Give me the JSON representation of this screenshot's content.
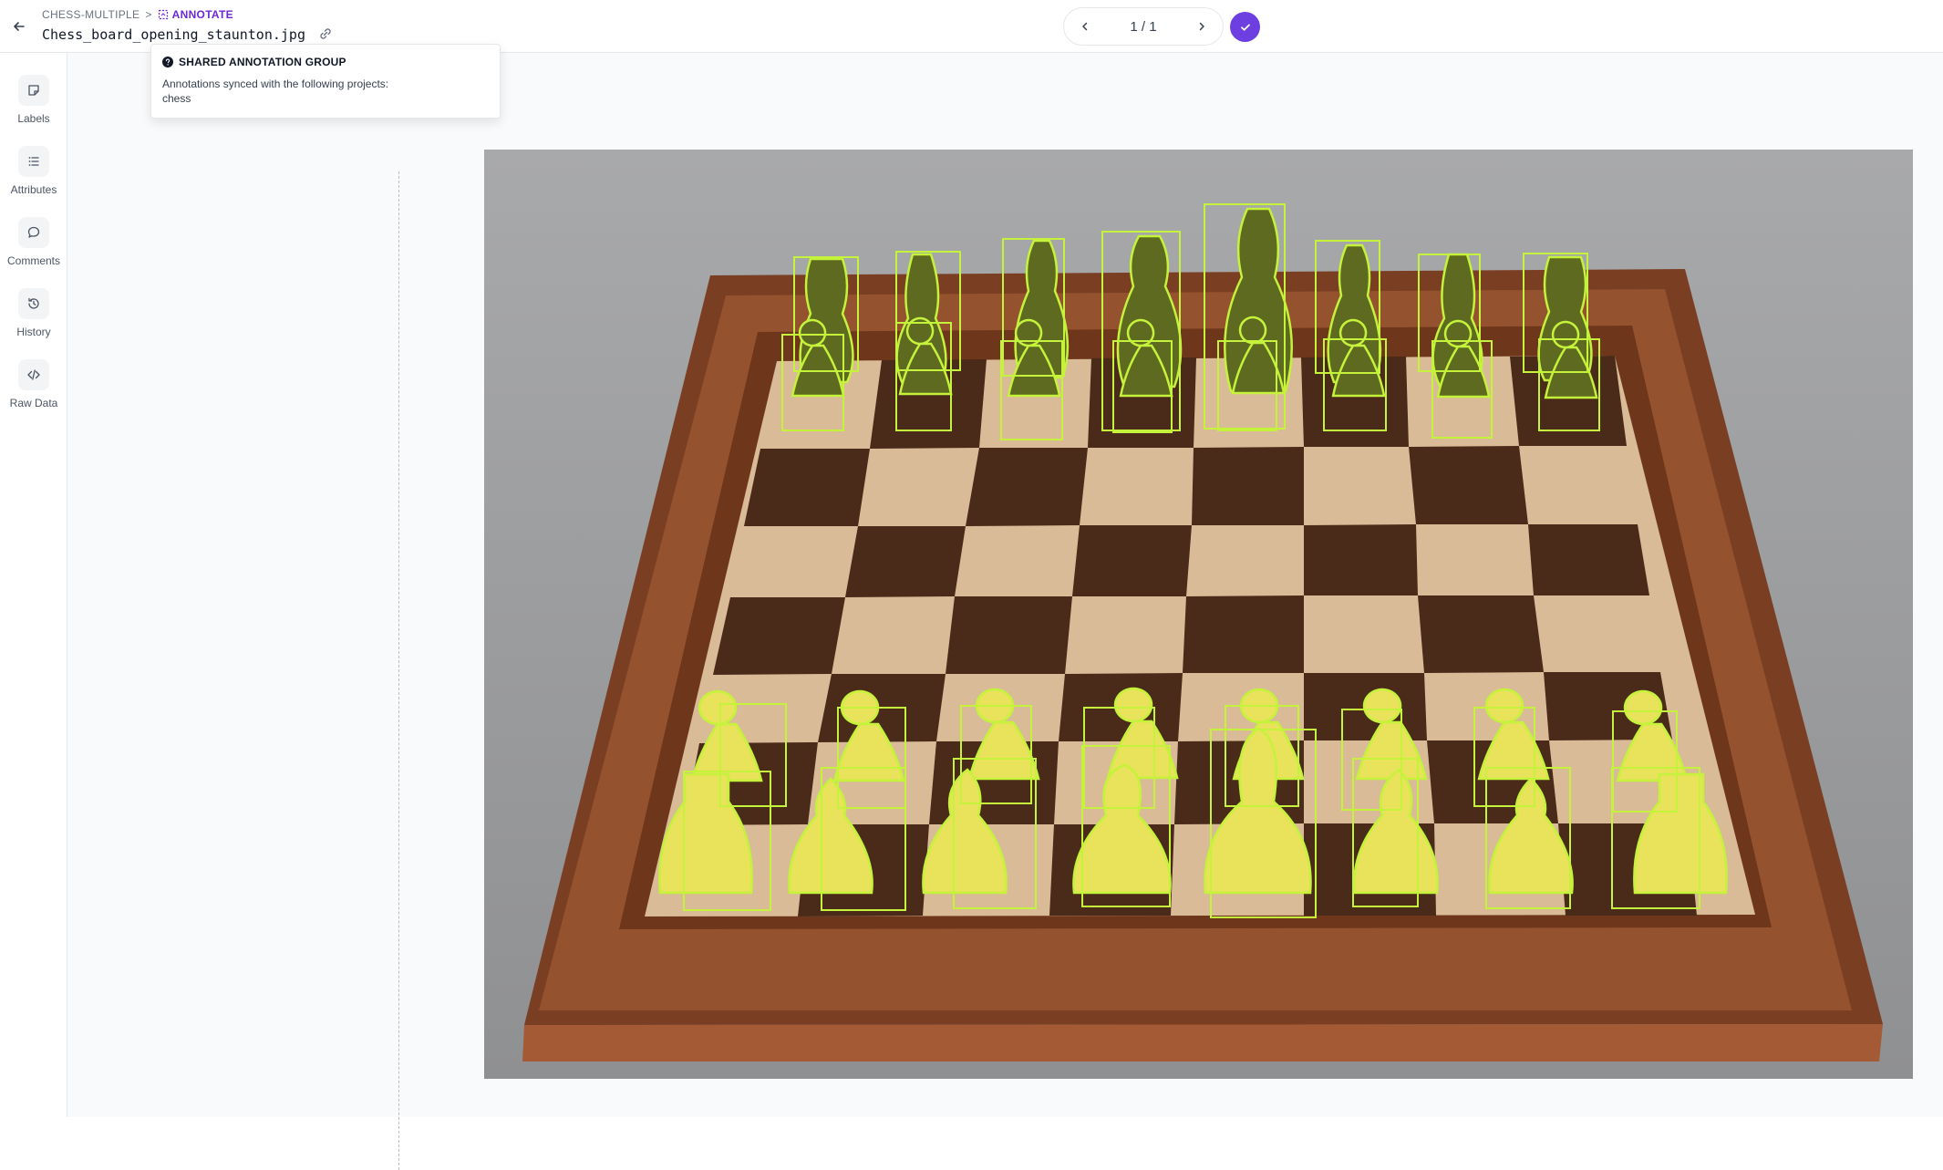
{
  "header": {
    "breadcrumb_project": "CHESS-MULTIPLE",
    "breadcrumb_separator": ">",
    "breadcrumb_mode": "ANNOTATE",
    "filename": "Chess_board_opening_staunton.jpg",
    "pager_text": "1 / 1"
  },
  "sidebar": {
    "items": [
      {
        "label": "Labels",
        "icon": "label-icon"
      },
      {
        "label": "Attributes",
        "icon": "list-icon"
      },
      {
        "label": "Comments",
        "icon": "comment-icon"
      },
      {
        "label": "History",
        "icon": "history-icon"
      },
      {
        "label": "Raw Data",
        "icon": "code-icon"
      }
    ]
  },
  "tooltip": {
    "title": "SHARED ANNOTATION GROUP",
    "line1": "Annotations synced with the following projects:",
    "line2": "chess"
  },
  "colors": {
    "accent": "#6d3fe0",
    "annotation": "#c5f23a"
  }
}
